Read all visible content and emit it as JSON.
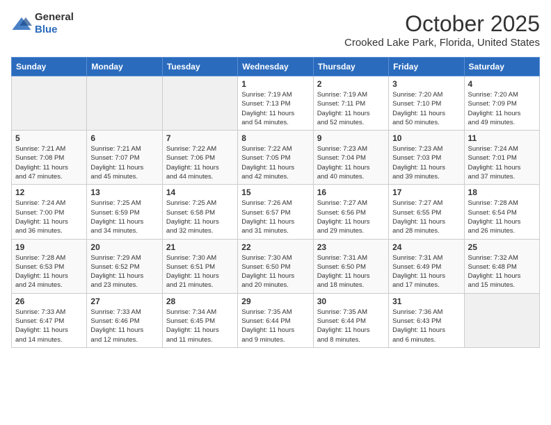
{
  "header": {
    "logo_general": "General",
    "logo_blue": "Blue",
    "month": "October 2025",
    "location": "Crooked Lake Park, Florida, United States"
  },
  "weekdays": [
    "Sunday",
    "Monday",
    "Tuesday",
    "Wednesday",
    "Thursday",
    "Friday",
    "Saturday"
  ],
  "weeks": [
    [
      {
        "day": "",
        "info": ""
      },
      {
        "day": "",
        "info": ""
      },
      {
        "day": "",
        "info": ""
      },
      {
        "day": "1",
        "info": "Sunrise: 7:19 AM\nSunset: 7:13 PM\nDaylight: 11 hours\nand 54 minutes."
      },
      {
        "day": "2",
        "info": "Sunrise: 7:19 AM\nSunset: 7:11 PM\nDaylight: 11 hours\nand 52 minutes."
      },
      {
        "day": "3",
        "info": "Sunrise: 7:20 AM\nSunset: 7:10 PM\nDaylight: 11 hours\nand 50 minutes."
      },
      {
        "day": "4",
        "info": "Sunrise: 7:20 AM\nSunset: 7:09 PM\nDaylight: 11 hours\nand 49 minutes."
      }
    ],
    [
      {
        "day": "5",
        "info": "Sunrise: 7:21 AM\nSunset: 7:08 PM\nDaylight: 11 hours\nand 47 minutes."
      },
      {
        "day": "6",
        "info": "Sunrise: 7:21 AM\nSunset: 7:07 PM\nDaylight: 11 hours\nand 45 minutes."
      },
      {
        "day": "7",
        "info": "Sunrise: 7:22 AM\nSunset: 7:06 PM\nDaylight: 11 hours\nand 44 minutes."
      },
      {
        "day": "8",
        "info": "Sunrise: 7:22 AM\nSunset: 7:05 PM\nDaylight: 11 hours\nand 42 minutes."
      },
      {
        "day": "9",
        "info": "Sunrise: 7:23 AM\nSunset: 7:04 PM\nDaylight: 11 hours\nand 40 minutes."
      },
      {
        "day": "10",
        "info": "Sunrise: 7:23 AM\nSunset: 7:03 PM\nDaylight: 11 hours\nand 39 minutes."
      },
      {
        "day": "11",
        "info": "Sunrise: 7:24 AM\nSunset: 7:01 PM\nDaylight: 11 hours\nand 37 minutes."
      }
    ],
    [
      {
        "day": "12",
        "info": "Sunrise: 7:24 AM\nSunset: 7:00 PM\nDaylight: 11 hours\nand 36 minutes."
      },
      {
        "day": "13",
        "info": "Sunrise: 7:25 AM\nSunset: 6:59 PM\nDaylight: 11 hours\nand 34 minutes."
      },
      {
        "day": "14",
        "info": "Sunrise: 7:25 AM\nSunset: 6:58 PM\nDaylight: 11 hours\nand 32 minutes."
      },
      {
        "day": "15",
        "info": "Sunrise: 7:26 AM\nSunset: 6:57 PM\nDaylight: 11 hours\nand 31 minutes."
      },
      {
        "day": "16",
        "info": "Sunrise: 7:27 AM\nSunset: 6:56 PM\nDaylight: 11 hours\nand 29 minutes."
      },
      {
        "day": "17",
        "info": "Sunrise: 7:27 AM\nSunset: 6:55 PM\nDaylight: 11 hours\nand 28 minutes."
      },
      {
        "day": "18",
        "info": "Sunrise: 7:28 AM\nSunset: 6:54 PM\nDaylight: 11 hours\nand 26 minutes."
      }
    ],
    [
      {
        "day": "19",
        "info": "Sunrise: 7:28 AM\nSunset: 6:53 PM\nDaylight: 11 hours\nand 24 minutes."
      },
      {
        "day": "20",
        "info": "Sunrise: 7:29 AM\nSunset: 6:52 PM\nDaylight: 11 hours\nand 23 minutes."
      },
      {
        "day": "21",
        "info": "Sunrise: 7:30 AM\nSunset: 6:51 PM\nDaylight: 11 hours\nand 21 minutes."
      },
      {
        "day": "22",
        "info": "Sunrise: 7:30 AM\nSunset: 6:50 PM\nDaylight: 11 hours\nand 20 minutes."
      },
      {
        "day": "23",
        "info": "Sunrise: 7:31 AM\nSunset: 6:50 PM\nDaylight: 11 hours\nand 18 minutes."
      },
      {
        "day": "24",
        "info": "Sunrise: 7:31 AM\nSunset: 6:49 PM\nDaylight: 11 hours\nand 17 minutes."
      },
      {
        "day": "25",
        "info": "Sunrise: 7:32 AM\nSunset: 6:48 PM\nDaylight: 11 hours\nand 15 minutes."
      }
    ],
    [
      {
        "day": "26",
        "info": "Sunrise: 7:33 AM\nSunset: 6:47 PM\nDaylight: 11 hours\nand 14 minutes."
      },
      {
        "day": "27",
        "info": "Sunrise: 7:33 AM\nSunset: 6:46 PM\nDaylight: 11 hours\nand 12 minutes."
      },
      {
        "day": "28",
        "info": "Sunrise: 7:34 AM\nSunset: 6:45 PM\nDaylight: 11 hours\nand 11 minutes."
      },
      {
        "day": "29",
        "info": "Sunrise: 7:35 AM\nSunset: 6:44 PM\nDaylight: 11 hours\nand 9 minutes."
      },
      {
        "day": "30",
        "info": "Sunrise: 7:35 AM\nSunset: 6:44 PM\nDaylight: 11 hours\nand 8 minutes."
      },
      {
        "day": "31",
        "info": "Sunrise: 7:36 AM\nSunset: 6:43 PM\nDaylight: 11 hours\nand 6 minutes."
      },
      {
        "day": "",
        "info": ""
      }
    ]
  ]
}
